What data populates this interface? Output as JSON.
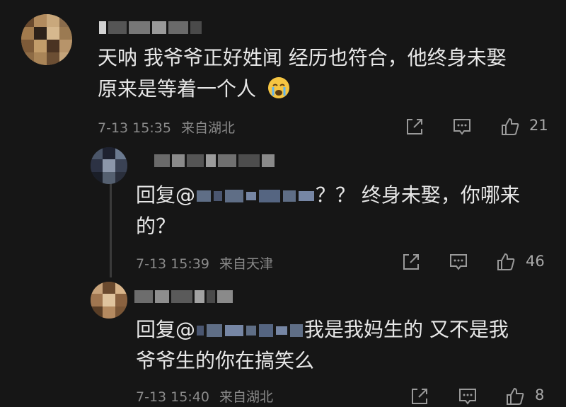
{
  "comments": [
    {
      "text_line1": "天呐 我爷爷正好姓闻 经历也符合，他终身未娶",
      "text_line2": "原来是等着一个人",
      "emoji": "crying-face-emoji",
      "time": "7-13 15:35",
      "location": "来自湖北",
      "likes": "21"
    },
    {
      "reply_prefix": "回复@",
      "text_line1_tail": "？？ 终身未娶，你哪来",
      "text_line2": "的？",
      "time": "7-13 15:39",
      "location": "来自天津",
      "likes": "46"
    },
    {
      "reply_prefix": "回复@",
      "text_line1_tail": "我是我妈生的 又不是我",
      "text_line2": "爷爷生的你在搞笑么",
      "time": "7-13 15:40",
      "location": "来自湖北",
      "likes": "8"
    }
  ],
  "icons": {
    "share": "share-icon",
    "comment": "comment-icon",
    "like": "thumbs-up-icon"
  },
  "colors": {
    "background": "#161616",
    "text": "#e7e7e7",
    "mention": "#6f86b6",
    "meta": "#8a8a8a"
  }
}
